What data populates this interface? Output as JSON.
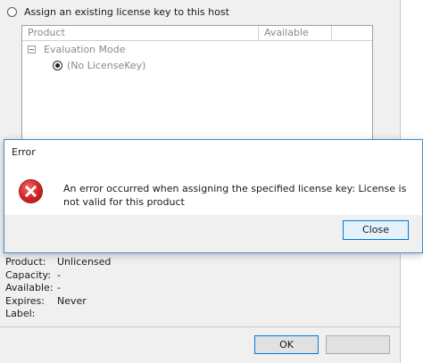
{
  "license_option": {
    "label": "Assign an existing license key to this host"
  },
  "product_table": {
    "columns": [
      "Product",
      "Available"
    ],
    "tree": {
      "group_label": "Evaluation Mode",
      "item_label": "(No LicenseKey)"
    }
  },
  "details": [
    {
      "label": "Product:",
      "value": "Unlicensed"
    },
    {
      "label": "Capacity:",
      "value": "-"
    },
    {
      "label": "Available:",
      "value": "-"
    },
    {
      "label": "Expires:",
      "value": "Never"
    },
    {
      "label": "Label:",
      "value": ""
    }
  ],
  "buttons": {
    "ok": "OK"
  },
  "error_dialog": {
    "title": "Error",
    "message": "An error occurred when assigning the specified license key: License is not valid for this product",
    "close_label": "Close"
  },
  "colors": {
    "error_icon": "#d42020",
    "focus_border": "#0078d7"
  }
}
